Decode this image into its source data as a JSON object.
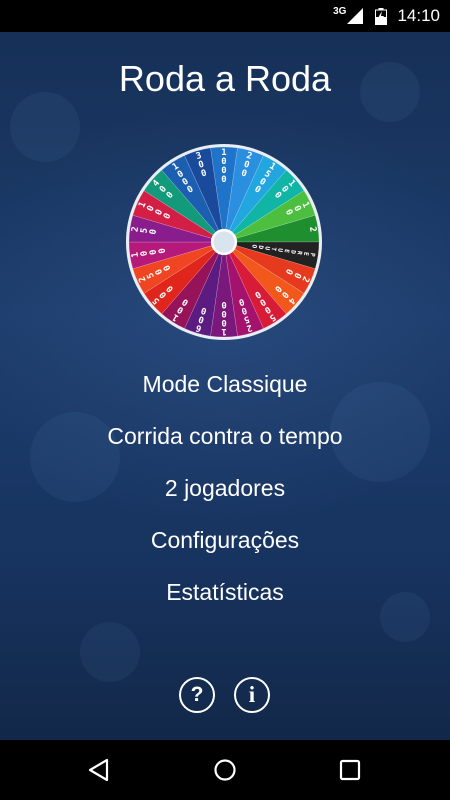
{
  "status_bar": {
    "network": "3G",
    "time": "14:10",
    "icons": [
      "signal-icon",
      "battery-icon"
    ]
  },
  "app": {
    "title": "Roda a Roda",
    "wheel": {
      "segments": [
        {
          "label": "1000",
          "color": "#1f73c8"
        },
        {
          "label": "200",
          "color": "#2a8fde"
        },
        {
          "label": "1500",
          "color": "#22a6e0"
        },
        {
          "label": "100",
          "color": "#10b5a5"
        },
        {
          "label": "100",
          "color": "#4cbf3f"
        },
        {
          "label": "2",
          "color": "#1e8e2e"
        },
        {
          "label": "PERDEU TUDO",
          "color": "#222222"
        },
        {
          "label": "200",
          "color": "#e63a1e"
        },
        {
          "label": "400",
          "color": "#f2581c"
        },
        {
          "label": "5000",
          "color": "#d81b36"
        },
        {
          "label": "2500",
          "color": "#a4126e"
        },
        {
          "label": "1000",
          "color": "#7a187c"
        },
        {
          "label": "600",
          "color": "#5c1b80"
        },
        {
          "label": "100",
          "color": "#96135a"
        },
        {
          "label": "500",
          "color": "#e0261c"
        },
        {
          "label": "2500",
          "color": "#ef4522"
        },
        {
          "label": "1000",
          "color": "#b51a7a"
        },
        {
          "label": "250",
          "color": "#8a1d8e"
        },
        {
          "label": "1000",
          "color": "#d31e46"
        },
        {
          "label": "400",
          "color": "#139a7a"
        },
        {
          "label": "1000",
          "color": "#1c5fb0"
        },
        {
          "label": "300",
          "color": "#1a4a9c"
        }
      ]
    },
    "menu": [
      {
        "label": "Mode Classique",
        "name": "menu-mode-classique"
      },
      {
        "label": "Corrida contra o tempo",
        "name": "menu-corrida-contra-o-tempo"
      },
      {
        "label": "2 jogadores",
        "name": "menu-2-jogadores"
      },
      {
        "label": "Configurações",
        "name": "menu-configuracoes"
      },
      {
        "label": "Estatísticas",
        "name": "menu-estatisticas"
      }
    ],
    "help_label": "?",
    "info_label": "i"
  },
  "colors": {
    "background_top": "#163057",
    "background_bottom": "#122849",
    "text": "#ffffff"
  }
}
